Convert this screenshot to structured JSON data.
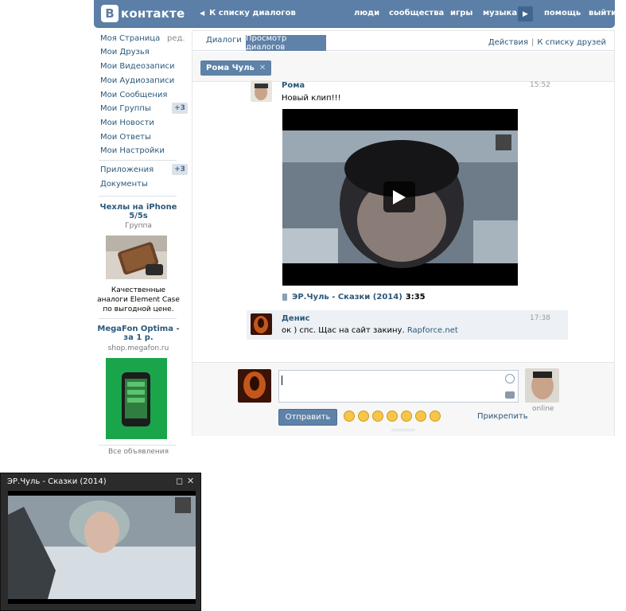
{
  "header": {
    "logo_letter": "В",
    "logo_text": "контакте",
    "back_link": "К списку диалогов",
    "nav": [
      "люди",
      "сообщества",
      "игры",
      "музыка",
      "помощь",
      "выйти"
    ]
  },
  "sidebar": {
    "items": [
      {
        "label": "Моя Страница",
        "extra": "ред."
      },
      {
        "label": "Мои Друзья"
      },
      {
        "label": "Мои Видеозаписи"
      },
      {
        "label": "Мои Аудиозаписи"
      },
      {
        "label": "Мои Сообщения"
      },
      {
        "label": "Мои Группы",
        "badge": "+3"
      },
      {
        "label": "Мои Новости"
      },
      {
        "label": "Мои Ответы"
      },
      {
        "label": "Мои Настройки"
      }
    ],
    "items2": [
      {
        "label": "Приложения",
        "badge": "+3"
      },
      {
        "label": "Документы"
      }
    ],
    "ads": [
      {
        "title_line1": "Чехлы на iPhone",
        "title_line2": "5/5s",
        "subtitle": "Группа",
        "desc_line1": "Качественные",
        "desc_line2": "аналоги Element Case",
        "desc_line3": "по выгодной цене."
      },
      {
        "title_line1": "MegaFon Optima -",
        "title_line2": "за 1 р.",
        "subtitle": "shop.megafon.ru"
      }
    ],
    "all_ads": "Все объявления"
  },
  "main": {
    "tabs": [
      "Диалоги",
      "Просмотр диалогов"
    ],
    "actions": [
      "Действия",
      "К списку друзей"
    ],
    "chip": "Рома Чуль",
    "messages": [
      {
        "name": "Рома",
        "time": "15:52",
        "text": "Новый клип!!!"
      },
      {
        "name": "Денис",
        "time": "17:38",
        "text": "ок ) спс. Щас на сайт закину. ",
        "link": "Rapforce.net"
      }
    ],
    "video": {
      "title": "ЭР.Чуль - Сказки (2014)",
      "duration": "3:35"
    },
    "composer": {
      "send": "Отправить",
      "attach": "Прикрепить",
      "online": "online"
    }
  },
  "mini_player": {
    "title": "ЭР.Чуль - Сказки (2014)"
  },
  "colors": {
    "brand": "#5b7fa6",
    "link": "#2b587a",
    "accent_button": "#5e82a8"
  }
}
